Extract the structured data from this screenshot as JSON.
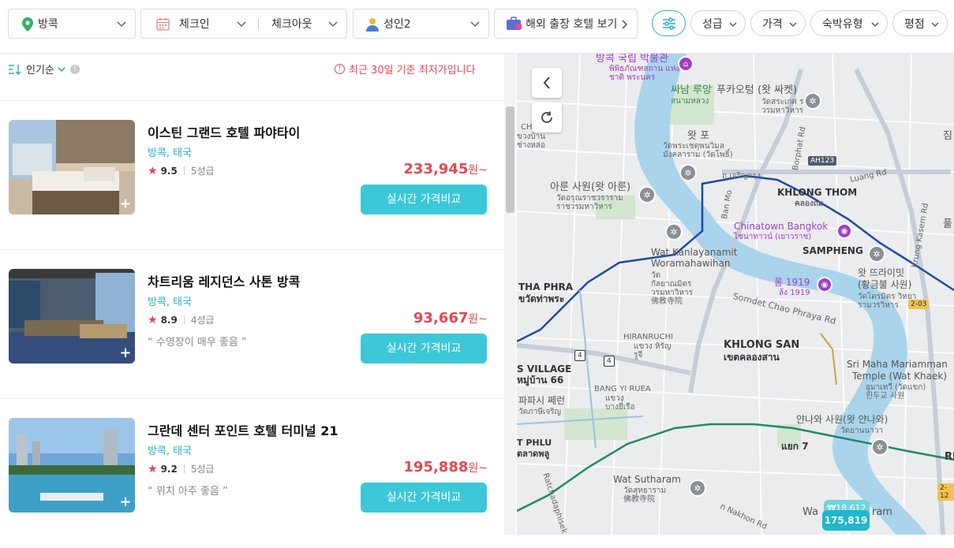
{
  "search": {
    "location": "방콕",
    "checkin": "체크인",
    "checkout": "체크아웃",
    "guests": "성인2",
    "hotel_ext_label": "해외 출장 호텔 보기"
  },
  "filters": {
    "pills": [
      "성급",
      "가격",
      "숙박유형",
      "평점"
    ]
  },
  "sort": {
    "label": "인기순",
    "notice": "최근 30일 기준 최저가입니다"
  },
  "hotels": [
    {
      "name": "이스틴 그랜드 호텔 파야타이",
      "location": "방콕, 태국",
      "score": "9.5",
      "grade": "5성급",
      "review": "",
      "price": "233,945",
      "unit": "원~",
      "button": "실시간 가격비교"
    },
    {
      "name": "차트리움 레지던스 사톤 방콕",
      "location": "방콕, 태국",
      "score": "8.9",
      "grade": "4성급",
      "review": "“ 수영장이 매우 좋음 ”",
      "price": "93,667",
      "unit": "원~",
      "button": "실시간 가격비교"
    },
    {
      "name": "그란데 센터 포인트 호텔 터미널 21",
      "location": "방콕, 태국",
      "score": "9.2",
      "grade": "5성급",
      "review": "“ 위치 아주 좋음 ”",
      "price": "195,888",
      "unit": "원~",
      "button": "실시간 가격비교"
    }
  ],
  "map": {
    "labels": {
      "museum": "방콕 국립 박물관",
      "museum_th": "พิพิธภัณฑสถาน แห่งชาติ พระนคร",
      "sanam_luang": "싸남 루앙",
      "sanam_luang_th": "สนามหลวง",
      "wat_pho_ko": "왓 포",
      "wat_pho_th": "วัดพระเชตุพนวิมลมังคลาราม (วัดโพธิ์)",
      "wat_saket": "푸카오텅 (왓 싸켓)",
      "wat_saket_th": "วัดสระเกศ ราชวรมหาวิหาร",
      "wat_arun": "아룬 사원(왓 아룬)",
      "wat_arun_th": "วัดอรุณราชวราราม ราชวรมหาวิหาร",
      "khlong_thom": "KHLONG THOM",
      "khlong_thom_th": "คลองถม",
      "chinatown": "Chinatown Bangkok",
      "chinatown_th": "ไชน่าทาวน์ (เยาวราช)",
      "wat_kanlaya": "Wat Kanlayanamit",
      "wat_kanlaya2": "Woramahawihan",
      "wat_kanlaya_th": "วัดกัลยาณมิตร วรมหาวิหาร 佛教寺院",
      "sampheng": "SAMPHENG",
      "thapra": "THA PHRA",
      "thapra_th": "ขวัดท่าพระ",
      "lhong1919": "롱 1919",
      "lhong1919_th": "ล้ง 1919",
      "wat_trimit": "왓 뜨라이밋",
      "wat_trimit2": "(황금불 사원)",
      "wat_trimit_th": "วัดไตรมิตร วิทยารามวรวิหาร",
      "somdet_rd": "Somdet Chao Phraya Rd",
      "khlong_san": "KHLONG SAN",
      "khlong_san_th": "เขตคลองสาน",
      "hiranruchi": "HIRANRUCHI",
      "hiranruchi_th": "แขวง หิรัญรูจี",
      "s_village": "S VILLAGE",
      "s_village_th": "หมู่บ้าน 66",
      "bang_yi_ruea": "BANG YI RUEA",
      "bang_yi_ruea_th": "แขวง บางยี่เรือ",
      "paphasi": "파파시 쩨런",
      "paphasi_th": "วัดภาษีเจริญ",
      "sri_maha": "Sri Maha Mariamman",
      "sri_maha2": "Temple (Wat Khaek)",
      "sri_maha_th": "อุมาเทวี (วัดแขก) 힌두교 사원",
      "wat_yannawa": "얀나와 사원(왓 얀나와)",
      "wat_yannawa_th": "วัดยานนาวา",
      "wat_suttharam": "Wat Sutharam",
      "wat_suttharam_th": "วัดสุทธาราม 佛教寺院",
      "phlu": "T PHLU",
      "phlu_th": "ตลาดพลู",
      "yaek7": "แยก 7",
      "ratchada": "Ratchadaphisek",
      "bonmo": "Ban Mo",
      "borphat": "Borphat Rd",
      "luang_rd": "Luang Rd",
      "krung_kasem": "Krung Kasem Rd",
      "charoen_krung": "ถ.เจริญกรุง",
      "nakhon_rd": "n Nakhon Rd",
      "ah123": "AH123",
      "badge_203": "2-03",
      "badge_212": "2-12",
      "badge_4a": "4",
      "badge_4b": "4",
      "wat_sutthat": "ขวงบ้าน ช่างหล่อ",
      "chi": "CHI",
      "jim": "짐",
      "pool": "풀",
      "ri": "RI",
      "wa": "Wa",
      "ram": "ram"
    },
    "price_marker_back": "₩18,612",
    "price_marker": "175,819"
  }
}
